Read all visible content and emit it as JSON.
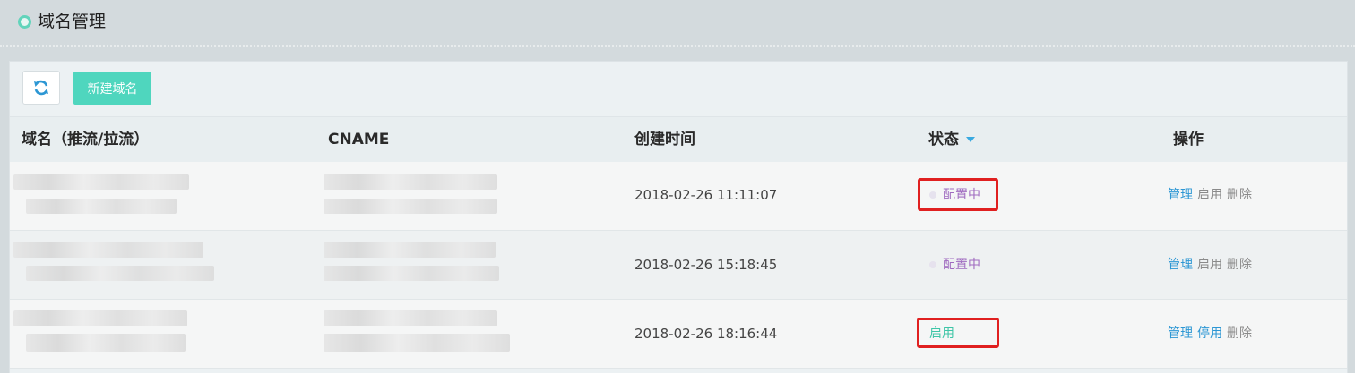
{
  "header": {
    "title": "域名管理"
  },
  "toolbar": {
    "refresh_icon": "refresh-icon",
    "add_label": "新建域名"
  },
  "table": {
    "columns": {
      "domain": "域名（推流/拉流）",
      "cname": "CNAME",
      "created": "创建时间",
      "status": "状态",
      "actions": "操作"
    },
    "rows": [
      {
        "created": "2018-02-26 11:11:07",
        "status": "配置中",
        "op1": "管理",
        "op2": "启用",
        "op3": "删除"
      },
      {
        "created": "2018-02-26 15:18:45",
        "status": "配置中",
        "op1": "管理",
        "op2": "启用",
        "op3": "删除"
      },
      {
        "created": "2018-02-26 18:16:44",
        "status": "启用",
        "op1": "管理",
        "op2": "停用",
        "op3": "删除"
      }
    ]
  },
  "colors": {
    "accent": "#4fd6be",
    "status_config": "#a06cc0",
    "status_enabled": "#3dc5a6",
    "link": "#2d97d4",
    "highlight": "#e02020"
  }
}
